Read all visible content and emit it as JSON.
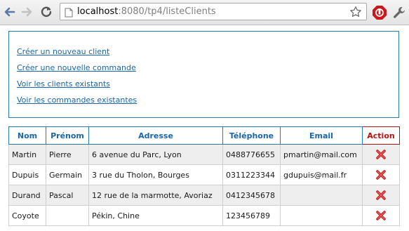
{
  "browser": {
    "url_host": "localhost",
    "url_rest": ":8080/tp4/listeClients"
  },
  "menu": {
    "items": [
      "Créer un nouveau client",
      "Créer une nouvelle commande",
      "Voir les clients existants",
      "Voir les commandes existantes"
    ]
  },
  "table": {
    "headers": [
      "Nom",
      "Prénom",
      "Adresse",
      "Téléphone",
      "Email",
      "Action"
    ],
    "rows": [
      {
        "nom": "Martin",
        "prenom": "Pierre",
        "adresse": "6 avenue du Parc, Lyon",
        "telephone": "0488776655",
        "email": "pmartin@mail.com"
      },
      {
        "nom": "Dupuis",
        "prenom": "Germain",
        "adresse": "3 rue du Tholon, Bourges",
        "telephone": "0311223344",
        "email": "gdupuis@mail.fr"
      },
      {
        "nom": "Durand",
        "prenom": "Pascal",
        "adresse": "12 rue de la marmotte, Avoriaz",
        "telephone": "0412345678",
        "email": ""
      },
      {
        "nom": "Coyote",
        "prenom": "",
        "adresse": "Pékin, Chine",
        "telephone": "123456789",
        "email": ""
      }
    ]
  },
  "colors": {
    "link": "#1a66a8",
    "border_blue": "#2a7ab0",
    "action_red": "#b31515",
    "row_alt": "#eeeeee"
  },
  "icons": [
    "back-arrow-icon",
    "forward-arrow-icon",
    "reload-icon",
    "page-icon",
    "star-icon",
    "stop-extension-icon",
    "wrench-icon",
    "delete-icon"
  ]
}
